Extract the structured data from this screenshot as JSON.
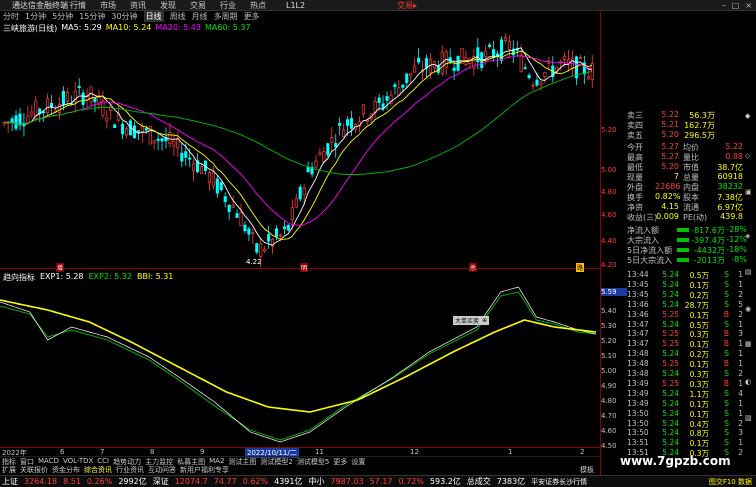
{
  "titlebar": {
    "app": "通达信金融终端",
    "menus": [
      "行情",
      "市场",
      "资讯",
      "发现",
      "交易",
      "行业",
      "热点"
    ],
    "code": "L1L2",
    "broker": "交易▸"
  },
  "periods": [
    "分时",
    "1分钟",
    "5分钟",
    "15分钟",
    "30分钟",
    "日线",
    "周线",
    "月线",
    "多周期",
    "更多"
  ],
  "active_period": "日线",
  "main_indicator": {
    "stock": "三峡旅游(日线)",
    "ma5": "MA5: 5.29",
    "ma10": "MA10: 5.24",
    "ma20": "MA20: 5.43",
    "ma60": "MA60: 5.37",
    "low_label": "4.22",
    "mark_1": "增",
    "mark_2": "明",
    "mark_3": "杀",
    "mark_4": "路"
  },
  "sub_indicator": {
    "name": "趋向指标",
    "exp1": "EXP1: 5.28",
    "exp2": "EXP2: 5.32",
    "bbi": "BBI: 5.31"
  },
  "popup": {
    "label": "大单买卖",
    "btn": "⊕"
  },
  "kline_yaxis": [
    "5.20",
    "5.00",
    "4.80",
    "4.60",
    "4.40",
    "4.20"
  ],
  "sub_yaxis": [
    "5.59",
    "5.40",
    "5.30",
    "5.20",
    "5.10",
    "5.00",
    "4.90",
    "4.80",
    "4.70",
    "4.60",
    "4.50"
  ],
  "xaxis": [
    "2022年",
    "6",
    "7",
    "8",
    "9",
    "10",
    "11",
    "12",
    "1",
    "2"
  ],
  "xaxis_cursor": "2022/10/11/二",
  "tabs1": [
    "指标",
    "窗口",
    "MACD",
    "VOL-TDX",
    "CCI",
    "趋势动力",
    "主力监控",
    "私募主图",
    "MA2",
    "测试主图",
    "测试模型2",
    "测试模型5",
    "更多",
    "设置"
  ],
  "tabs2": [
    "扩展",
    "关联报价",
    "资金分布",
    "综合资讯",
    "行业资讯",
    "互动问答",
    "新用户福利专享"
  ],
  "tabs2_active": "综合资讯",
  "tabs_right": "模板",
  "quotes_ask": [
    {
      "l": "卖三",
      "v": "5.22",
      "q": "56.3万"
    },
    {
      "l": "卖四",
      "v": "5.21",
      "q": "162.7万"
    },
    {
      "l": "卖五",
      "v": "5.20",
      "q": "296.5万"
    }
  ],
  "quote_rows": [
    {
      "l": "今开",
      "v": "5.27",
      "l2": "均价",
      "v2": "5.22"
    },
    {
      "l": "最高",
      "v": "5.27",
      "l2": "量比",
      "v2": "0.88"
    },
    {
      "l": "最低",
      "v": "5.20",
      "l2": "市值",
      "v2": "38.7亿"
    },
    {
      "l": "现量",
      "v": "7",
      "l2": "总量",
      "v2": "60918"
    },
    {
      "l": "外盘",
      "v": "22686",
      "l2": "内盘",
      "v2": "38232"
    },
    {
      "l": "换手",
      "v": "0.82%",
      "l2": "股本",
      "v2": "7.38亿"
    },
    {
      "l": "净资",
      "v": "4.15",
      "l2": "流通",
      "v2": "6.97亿"
    },
    {
      "l": "收益(三)",
      "v": "0.009",
      "l2": "PE(动)",
      "v2": "439.8"
    }
  ],
  "flow_rows": [
    {
      "l": "净流入额",
      "v": "-817.6万",
      "pct": "-28%"
    },
    {
      "l": "大宗流入",
      "v": "-397.4万",
      "pct": "-12%"
    },
    {
      "l": "5日净流入额",
      "v": "-4432万",
      "pct": "-18%"
    },
    {
      "l": "5日大宗流入",
      "v": "-2013万",
      "pct": "-8%"
    }
  ],
  "ticks": [
    {
      "t": "13:44",
      "p": "5.24",
      "q": "0.5万",
      "d": "S",
      "n": "1"
    },
    {
      "t": "13:45",
      "p": "5.24",
      "q": "0.1万",
      "d": "S",
      "n": "1"
    },
    {
      "t": "13:45",
      "p": "5.24",
      "q": "0.2万",
      "d": "S",
      "n": "2"
    },
    {
      "t": "13:46",
      "p": "5.24",
      "q": "28.7万",
      "d": "S",
      "n": "5"
    },
    {
      "t": "13:46",
      "p": "5.25",
      "q": "0.1万",
      "d": "B",
      "n": "2"
    },
    {
      "t": "13:47",
      "p": "5.24",
      "q": "0.5万",
      "d": "S",
      "n": "1"
    },
    {
      "t": "13:47",
      "p": "5.25",
      "q": "0.3万",
      "d": "B",
      "n": "3"
    },
    {
      "t": "13:47",
      "p": "5.25",
      "q": "0.1万",
      "d": "B",
      "n": "1"
    },
    {
      "t": "13:48",
      "p": "5.24",
      "q": "0.2万",
      "d": "S",
      "n": "1"
    },
    {
      "t": "13:48",
      "p": "5.25",
      "q": "0.1万",
      "d": "B",
      "n": "1"
    },
    {
      "t": "13:48",
      "p": "5.24",
      "q": "0.3万",
      "d": "S",
      "n": "2"
    },
    {
      "t": "13:49",
      "p": "5.25",
      "q": "0.3万",
      "d": "B",
      "n": "1"
    },
    {
      "t": "13:49",
      "p": "5.24",
      "q": "1.1万",
      "d": "S",
      "n": "4"
    },
    {
      "t": "13:49",
      "p": "5.24",
      "q": "0.1万",
      "d": "S",
      "n": "1"
    },
    {
      "t": "13:50",
      "p": "5.24",
      "q": "0.1万",
      "d": "S",
      "n": "1"
    },
    {
      "t": "13:50",
      "p": "5.24",
      "q": "0.4万",
      "d": "S",
      "n": "2"
    },
    {
      "t": "13:50",
      "p": "5.24",
      "q": "0.8万",
      "d": "S",
      "n": "3"
    },
    {
      "t": "13:51",
      "p": "5.24",
      "q": "0.1万",
      "d": "S",
      "n": "1"
    },
    {
      "t": "13:51",
      "p": "5.24",
      "q": "0.3万",
      "d": "S",
      "n": "2"
    }
  ],
  "statusbar": {
    "sh_label": "上证",
    "sh_val": "3264.18",
    "sh_chg": "8.51",
    "sh_pct": "0.26%",
    "sh_amt": "2992亿",
    "sz_label": "深证",
    "sz_val": "12074.7",
    "sz_chg": "74.77",
    "sz_pct": "0.62%",
    "sz_amt": "4391亿",
    "zx_label": "中小",
    "zx_val": "7987.03",
    "zx_chg": "57.17",
    "zx_pct": "0.72%",
    "zx_amt": "593.2亿",
    "zb_label": "总成交",
    "zb_amt": "7383亿",
    "broker": "平安证券长沙行情",
    "right": "图交F10 数据"
  },
  "watermark": "www.7gpzb.com",
  "colors": {
    "up": "#ff3c3c",
    "down": "#00ffff",
    "ma5": "#ffffff",
    "ma10": "#ffff00",
    "ma20": "#ff00ff",
    "ma60": "#00c000",
    "exp1": "#ffffff",
    "exp2": "#00c000",
    "bbi": "#ffff00"
  }
}
